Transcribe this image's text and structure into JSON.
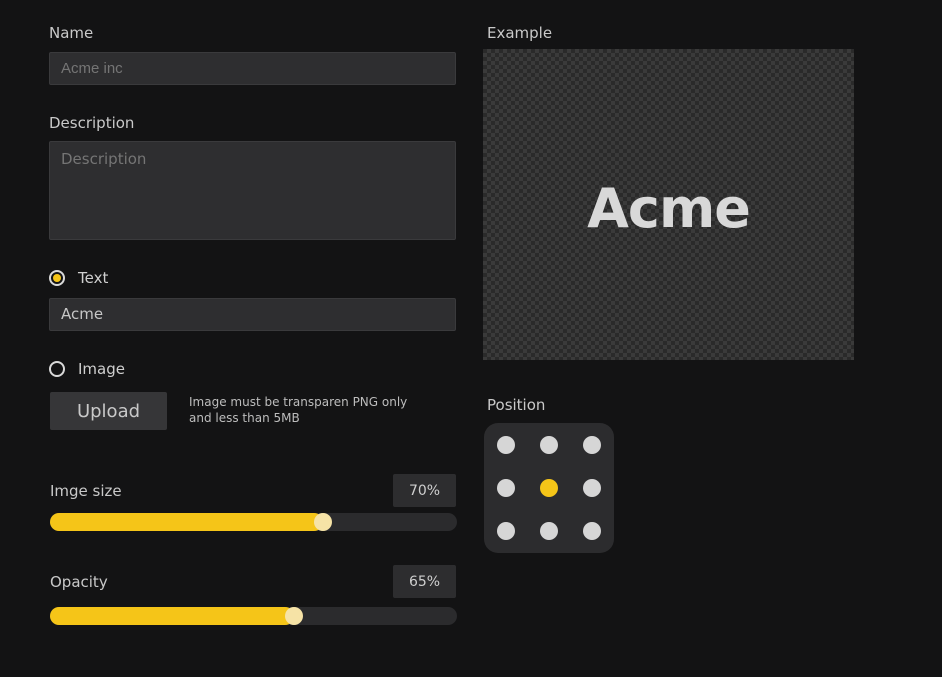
{
  "form": {
    "name_label": "Name",
    "name_value": "",
    "name_placeholder": "Acme inc",
    "description_label": "Description",
    "description_value": "",
    "description_placeholder": "Description",
    "text_option_label": "Text",
    "text_option_selected": true,
    "text_value": "Acme",
    "image_option_label": "Image",
    "image_option_selected": false,
    "upload_label": "Upload",
    "upload_hint_line1": "Image must be transparen PNG only",
    "upload_hint_line2": "and less than 5MB"
  },
  "sliders": {
    "size_label": "Imge size",
    "size_value_text": "70%",
    "size_value": 0.67,
    "opacity_label": "Opacity",
    "opacity_value_text": "65%",
    "opacity_value": 0.6
  },
  "example": {
    "label": "Example",
    "preview_text": "Acme"
  },
  "position": {
    "label": "Position",
    "options": [
      "top-left",
      "top-center",
      "top-right",
      "middle-left",
      "center",
      "middle-right",
      "bottom-left",
      "bottom-center",
      "bottom-right"
    ],
    "selected": "center"
  },
  "colors": {
    "accent": "#f5c518",
    "background": "#131314",
    "input_bg": "#2e2e30"
  }
}
